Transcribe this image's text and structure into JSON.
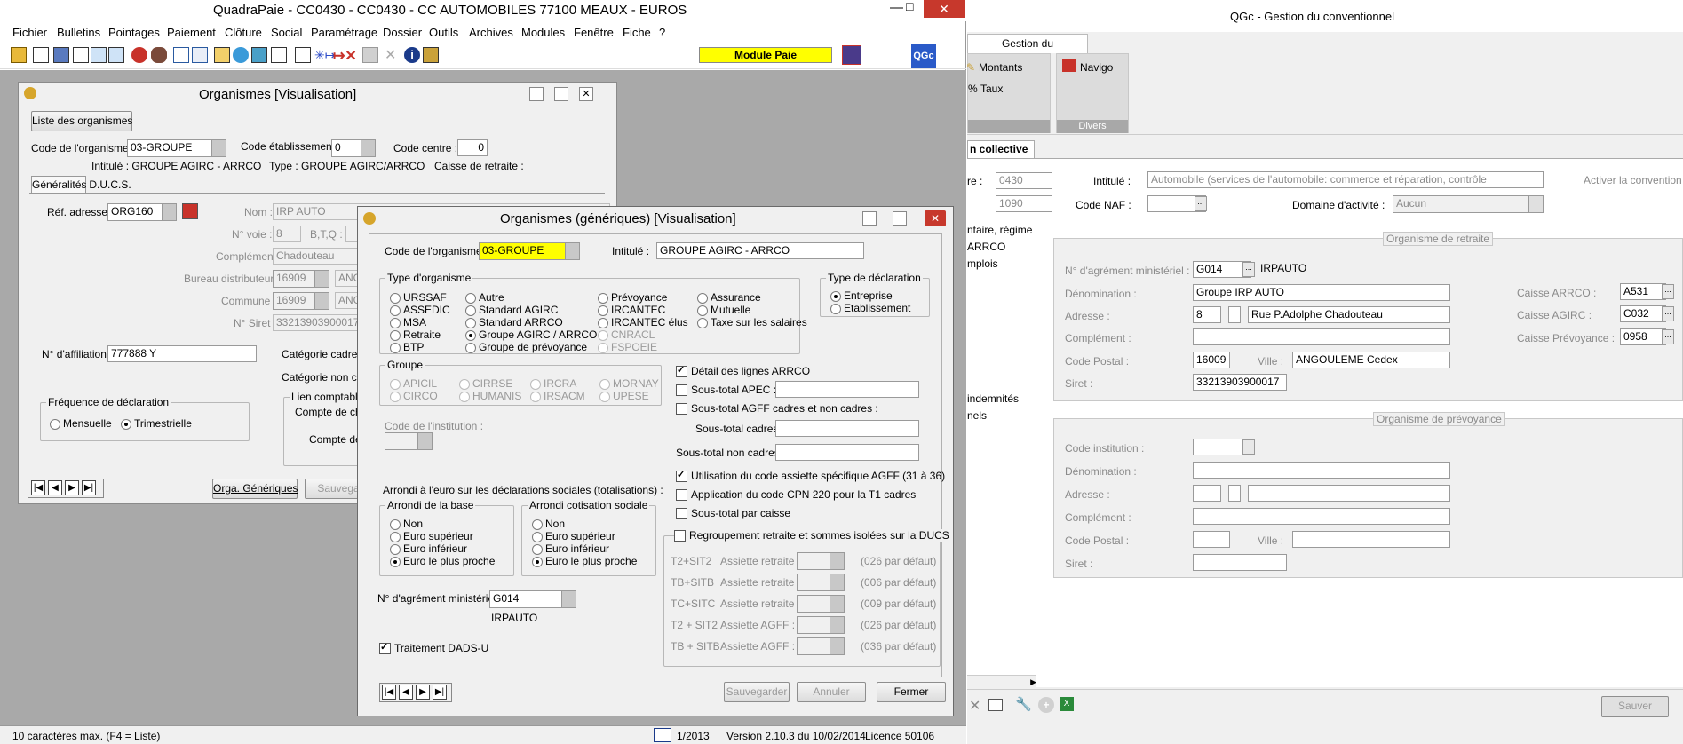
{
  "main": {
    "title": "QuadraPaie - CC0430 - CC0430 - CC AUTOMOBILES 77100 MEAUX - EUROS",
    "menu": [
      "Fichier",
      "Bulletins",
      "Pointages",
      "Paiement",
      "Clôture",
      "Social",
      "Paramétrage",
      "Dossier",
      "Outils",
      "Archives",
      "Modules",
      "Fenêtre",
      "Fiche",
      "?"
    ],
    "module_label": "Module Paie",
    "toolbar_icons": [
      "folder-open-icon",
      "document-icon",
      "search-people-icon",
      "grid-icon",
      "print-icon",
      "person-red-icon",
      "people-search-icon",
      "calendar-icon",
      "bar-chart-icon",
      "globe-icon",
      "book-icon",
      "print-preview-icon",
      "document-arrow-icon",
      "star-arrow-icon",
      "delete-x-icon",
      "save-disk-icon",
      "close-doc-icon",
      "info-icon",
      "exit-door-icon"
    ]
  },
  "org": {
    "title": "Organismes   [Visualisation]",
    "list_button": "Liste des organismes",
    "code_label": "Code de l'organisme :",
    "code_value": "03-GROUPE",
    "etab_label": "Code établissement :",
    "etab_value": "0",
    "centre_label": "Code centre :",
    "centre_value": "0",
    "intitule_text": "Intitulé : GROUPE AGIRC - ARRCO",
    "type_text": "Type : GROUPE AGIRC/ARRCO",
    "caisse_text": "Caisse de retraite :",
    "tabs": [
      "Généralités",
      "D.U.C.S."
    ],
    "ref_label": "Réf. adresse :",
    "ref_value": "ORG160",
    "nom_label": "Nom :",
    "nom_value": "IRP AUTO",
    "voie_label": "N° voie :",
    "voie_value": "8",
    "btq_label": "B,T,Q :",
    "complement_label": "Complément :",
    "complement_value": "Chadouteau",
    "bureau_label": "Bureau distributeur :",
    "bureau_value": "16909",
    "bureau_ville": "ANG",
    "commune_label": "Commune :",
    "commune_value": "16909",
    "commune_ville": "ANG",
    "siret_label": "N° Siret :",
    "siret_value": "33213903900017",
    "affil_label": "N° d'affiliation :",
    "affil_value": "777888 Y",
    "cat_cadres": "Catégorie cadres :",
    "cat_non_cadres": "Catégorie non cad",
    "freq_title": "Fréquence de déclaration",
    "freq_options": [
      "Mensuelle",
      "Trimestrielle"
    ],
    "lien_title": "Lien comptable",
    "compte_charge": "Compte de char",
    "compte_tiers": "Compte de ti",
    "orga_btn": "Orga. Génériques",
    "sauver_btn": "Sauvegar"
  },
  "gen": {
    "title": "Organismes (génériques)   [Visualisation]",
    "code_label": "Code de l'organisme :",
    "code_value": "03-GROUPE",
    "intitule_label": "Intitulé :",
    "intitule_value": "GROUPE AGIRC - ARRCO",
    "type_org_title": "Type d'organisme",
    "type_org": [
      {
        "label": "URSSAF",
        "on": false,
        "dis": false
      },
      {
        "label": "ASSEDIC",
        "on": false,
        "dis": false
      },
      {
        "label": "MSA",
        "on": false,
        "dis": false
      },
      {
        "label": "Retraite",
        "on": false,
        "dis": false
      },
      {
        "label": "BTP",
        "on": false,
        "dis": false
      },
      {
        "label": "Autre",
        "on": false,
        "dis": false
      },
      {
        "label": "Standard AGIRC",
        "on": false,
        "dis": false
      },
      {
        "label": "Standard ARRCO",
        "on": false,
        "dis": false
      },
      {
        "label": "Groupe AGIRC / ARRCO",
        "on": true,
        "dis": false
      },
      {
        "label": "Groupe de prévoyance",
        "on": false,
        "dis": false
      },
      {
        "label": "Prévoyance",
        "on": false,
        "dis": false
      },
      {
        "label": "IRCANTEC",
        "on": false,
        "dis": false
      },
      {
        "label": "IRCANTEC élus",
        "on": false,
        "dis": false
      },
      {
        "label": "CNRACL",
        "on": false,
        "dis": true
      },
      {
        "label": "FSPOEIE",
        "on": false,
        "dis": true
      },
      {
        "label": "Assurance",
        "on": false,
        "dis": false
      },
      {
        "label": "Mutuelle",
        "on": false,
        "dis": false
      },
      {
        "label": "Taxe sur les salaires",
        "on": false,
        "dis": false
      }
    ],
    "type_decl_title": "Type de déclaration",
    "type_decl": [
      "Entreprise",
      "Etablissement"
    ],
    "groupe_title": "Groupe",
    "groupe": [
      "APICIL",
      "CIRCO",
      "CIRRSE",
      "HUMANIS",
      "IRCRA",
      "IRSACM",
      "MORNAY",
      "UPESE"
    ],
    "code_inst_label": "Code de l'institution :",
    "arrondi_text": "Arrondi à l'euro sur les déclarations sociales (totalisations) :",
    "arr_base_title": "Arrondi de la base",
    "arr_cot_title": "Arrondi cotisation sociale",
    "arr_options": [
      "Non",
      "Euro supérieur",
      "Euro inférieur",
      "Euro le plus proche"
    ],
    "agrement_label": "N° d'agrément ministériel :",
    "agrement_value": "G014",
    "agrement_name": "IRPAUTO",
    "dads_label": "Traitement DADS-U",
    "detail_arrco": "Détail des lignes ARRCO",
    "sous_apec": "Sous-total APEC :",
    "sous_agff": "Sous-total AGFF cadres et non cadres :",
    "sous_cadres": "Sous-total cadres :",
    "sous_non_cadres": "Sous-total non cadres :",
    "util_agff": "Utilisation du code assiette spécifique AGFF (31 à 36)",
    "app_cpn": "Application du code CPN 220 pour la T1 cadres",
    "sous_caisse": "Sous-total par caisse",
    "regroup_title": "Regroupement retraite et sommes isolées sur la DUCS",
    "regroup_rows": [
      {
        "code": "T2+SIT2",
        "label": "Assiette retraite :",
        "def": "(026 par défaut)"
      },
      {
        "code": "TB+SITB",
        "label": "Assiette retraite :",
        "def": "(006 par défaut)"
      },
      {
        "code": "TC+SITC",
        "label": "Assiette retraite :",
        "def": "(009 par défaut)"
      },
      {
        "code": "T2 + SIT2",
        "label": "Assiette AGFF :",
        "def": "(026 par défaut)"
      },
      {
        "code": "TB + SITB",
        "label": "Assiette AGFF :",
        "def": "(036 par défaut)"
      }
    ],
    "btn_save": "Sauvegarder",
    "btn_cancel": "Annuler",
    "btn_close": "Fermer"
  },
  "status": {
    "hint": "10 caractères max. (F4 = Liste)",
    "period": "1/2013",
    "version": "Version 2.10.3 du 10/02/2014",
    "licence": "Licence 50106"
  },
  "qgc": {
    "title": "QGc - Gestion du conventionnel",
    "ribbon_tab": "Gestion du conventionnel",
    "montants": "Montants",
    "taux": "Taux",
    "navigo": "Navigo",
    "divers": "Divers",
    "doc_tab": "n collective",
    "cc_label": "re :",
    "cc_value": "0430",
    "idcc_value": "1090",
    "intitule_label": "Intitulé :",
    "intitule_value": "Automobile (services de l'automobile: commerce et réparation, contrôle",
    "activer": "Activer la convention",
    "naf_label": "Code NAF :",
    "domaine_label": "Domaine d'activité :",
    "domaine_value": "Aucun",
    "left_items": [
      "ntaire, régime",
      "ARRCO",
      "mplois",
      "indemnités",
      "nels"
    ],
    "retraite_title": "Organisme de retraite",
    "agrement_label": "N° d'agrément ministériel :",
    "agrement_value": "G014",
    "agrement_name": "IRPAUTO",
    "denom_label": "Dénomination :",
    "denom_value": "Groupe IRP AUTO",
    "adresse_label": "Adresse :",
    "adresse_num": "8",
    "adresse_rue": "Rue P.Adolphe Chadouteau",
    "complement_label": "Complément :",
    "cp_label": "Code Postal :",
    "cp_value": "16009",
    "ville_label": "Ville :",
    "ville_value": "ANGOULEME Cedex",
    "siret_label": "Siret :",
    "siret_value": "33213903900017",
    "caisse_arrco_label": "Caisse ARRCO :",
    "caisse_arrco": "A531",
    "caisse_agirc_label": "Caisse AGIRC :",
    "caisse_agirc": "C032",
    "caisse_prev_label": "Caisse Prévoyance :",
    "caisse_prev": "0958",
    "prev_title": "Organisme de prévoyance",
    "code_inst_label": "Code institution :",
    "save_btn": "Sauver"
  }
}
